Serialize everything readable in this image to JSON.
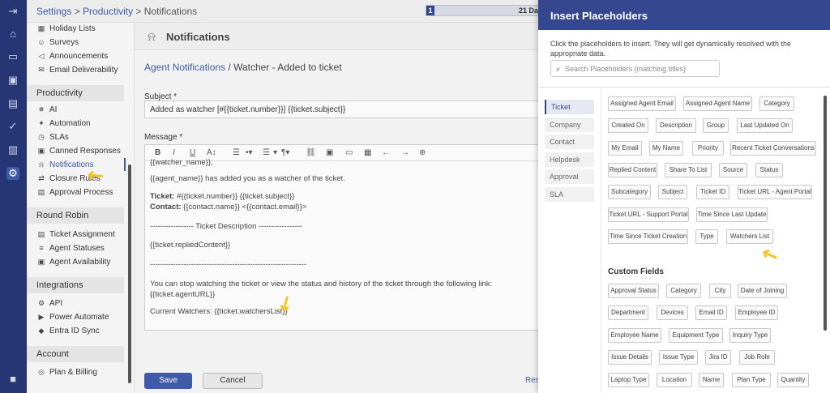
{
  "breadcrumb": {
    "settings": "Settings",
    "sep1": " > ",
    "productivity": "Productivity",
    "sep2": " > ",
    "current": "Notifications"
  },
  "trial": {
    "number": "1",
    "label": "21 Day"
  },
  "rail_icons": [
    "logout-icon",
    "home-icon",
    "ticket-icon",
    "contacts-icon",
    "book-icon",
    "check-icon",
    "reports-icon",
    "settings-icon",
    "chat-icon"
  ],
  "sidebar": {
    "top_items": [
      {
        "label": "Holiday Lists",
        "icon": "calendar-icon"
      },
      {
        "label": "Surveys",
        "icon": "smile-icon"
      },
      {
        "label": "Announcements",
        "icon": "megaphone-icon"
      },
      {
        "label": "Email Deliverability",
        "icon": "mail-icon"
      }
    ],
    "productivity_title": "Productivity",
    "productivity_items": [
      {
        "label": "AI",
        "icon": "ai-icon"
      },
      {
        "label": "Automation",
        "icon": "automation-icon"
      },
      {
        "label": "SLAs",
        "icon": "sla-icon"
      },
      {
        "label": "Canned Responses",
        "icon": "canned-icon"
      },
      {
        "label": "Notifications",
        "icon": "bell-icon"
      },
      {
        "label": "Closure Rules",
        "icon": "closure-icon"
      },
      {
        "label": "Approval Process",
        "icon": "approval-icon"
      }
    ],
    "roundrobin_title": "Round Robin",
    "roundrobin_items": [
      {
        "label": "Ticket Assignment",
        "icon": "assign-icon"
      },
      {
        "label": "Agent Statuses",
        "icon": "status-icon"
      },
      {
        "label": "Agent Availability",
        "icon": "availability-icon"
      }
    ],
    "integrations_title": "Integrations",
    "integrations_items": [
      {
        "label": "API",
        "icon": "api-icon"
      },
      {
        "label": "Power Automate",
        "icon": "power-icon"
      },
      {
        "label": "Entra ID Sync",
        "icon": "sync-icon"
      }
    ],
    "account_title": "Account",
    "account_items": [
      {
        "label": "Plan & Billing",
        "icon": "billing-icon"
      }
    ]
  },
  "main": {
    "title": "Notifications",
    "crumb_link": "Agent Notifications",
    "crumb_rest": " / Watcher - Added to ticket",
    "subject_label": "Subject *",
    "subject_value": "Added as watcher [#{{ticket.number}}] {{ticket.subject}}",
    "message_label": "Message *",
    "toolbar": [
      "B",
      "I",
      "U",
      "A↕",
      "☰",
      "•▾",
      "☰",
      "▾",
      "¶▾",
      "⛓",
      "▣",
      "▭",
      "▦",
      "←",
      "→",
      "⊕"
    ],
    "body": {
      "line0": "{{watcher_name}},",
      "line1": "{{agent_name}} has added you as a watcher of the ticket.",
      "ticket_label": "Ticket: ",
      "ticket_value": "#{{ticket.number}} {{ticket.subject}}",
      "contact_label": "Contact: ",
      "contact_value": "{{contact.name}} <{{contact.email}}>",
      "desc_header": "----------------- Ticket Description -----------------",
      "replied": "{{ticket.repliedContent}}",
      "rule": "-------------------------------------------------------------",
      "stop": "You can stop watching the ticket or view the status and history of the ticket through the following link:",
      "url": "{{ticket.agentURL}}",
      "watchers": "Current Watchers: {{ticket.watchersList}}"
    },
    "save_label": "Save",
    "cancel_label": "Cancel",
    "reset_label": "Rese"
  },
  "panel": {
    "title": "Insert Placeholders",
    "description": "Click the placeholders to insert. They will get dynamically resolved with the appropriate data.",
    "search_placeholder": "Search Placeholders (matching titles)",
    "tabs": [
      "Ticket",
      "Company",
      "Contact",
      "Helpdesk",
      "Approval",
      "SLA"
    ],
    "active_tab": "Ticket",
    "ticket_chips": [
      "Assigned Agent Email",
      "Assigned Agent Name",
      "Category",
      "Created On",
      "Description",
      "Group",
      "Last Updated On",
      "My Email",
      "My Name",
      "Priority",
      "Recent Ticket Conversations",
      "Replied Content",
      "Share To List",
      "Source",
      "Status",
      "Subcategory",
      "Subject",
      "Ticket ID",
      "Ticket URL - Agent Portal",
      "Ticket URL - Support Portal",
      "Time Since Last Update",
      "Time Since Ticket Creation",
      "Type",
      "Watchers List"
    ],
    "custom_fields_title": "Custom Fields",
    "custom_chips": [
      "Approval Status",
      "Category",
      "City",
      "Date of Joining",
      "Department",
      "Devices",
      "Email ID",
      "Employee ID",
      "Employee Name",
      "Equipment Type",
      "Inquiry Type",
      "Issue Details",
      "Issue Type",
      "Jira ID",
      "Job Role",
      "Laptop Type",
      "Location",
      "Name",
      "Plan Type",
      "Quantity"
    ]
  }
}
